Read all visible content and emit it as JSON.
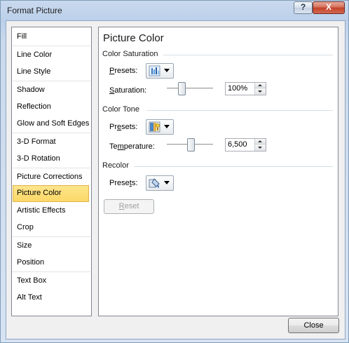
{
  "window": {
    "title": "Format Picture",
    "help_glyph": "?",
    "close_glyph": "X"
  },
  "nav": {
    "items": [
      {
        "label": "Fill"
      },
      {
        "label": "Line Color"
      },
      {
        "label": "Line Style"
      },
      {
        "label": "Shadow"
      },
      {
        "label": "Reflection"
      },
      {
        "label": "Glow and Soft Edges"
      },
      {
        "label": "3-D Format"
      },
      {
        "label": "3-D Rotation"
      },
      {
        "label": "Picture Corrections"
      },
      {
        "label": "Picture Color",
        "selected": true
      },
      {
        "label": "Artistic Effects"
      },
      {
        "label": "Crop"
      },
      {
        "label": "Size"
      },
      {
        "label": "Position"
      },
      {
        "label": "Text Box"
      },
      {
        "label": "Alt Text"
      }
    ]
  },
  "pane": {
    "title": "Picture Color",
    "color_saturation": {
      "heading": "Color Saturation",
      "presets_label_pre": "",
      "presets_label_ul": "P",
      "presets_label_post": "resets:",
      "saturation_label_pre": "",
      "saturation_label_ul": "S",
      "saturation_label_post": "aturation:",
      "saturation_value": "100%",
      "slider_level": 0.33
    },
    "color_tone": {
      "heading": "Color Tone",
      "presets_label_pre": "Pr",
      "presets_label_ul": "e",
      "presets_label_post": "sets:",
      "temperature_label_pre": "Te",
      "temperature_label_ul": "m",
      "temperature_label_post": "perature:",
      "temperature_value": "6,500",
      "slider_level": 0.5
    },
    "recolor": {
      "heading": "Recolor",
      "presets_label_pre": "Prese",
      "presets_label_ul": "t",
      "presets_label_post": "s:"
    },
    "reset_label_pre": "",
    "reset_label_ul": "R",
    "reset_label_post": "eset"
  },
  "footer": {
    "close_label": "Close"
  },
  "icons": {
    "saturation_preset": "saturation-preset-icon",
    "tone_preset": "color-tone-preset-icon",
    "recolor_preset": "recolor-preset-icon"
  }
}
